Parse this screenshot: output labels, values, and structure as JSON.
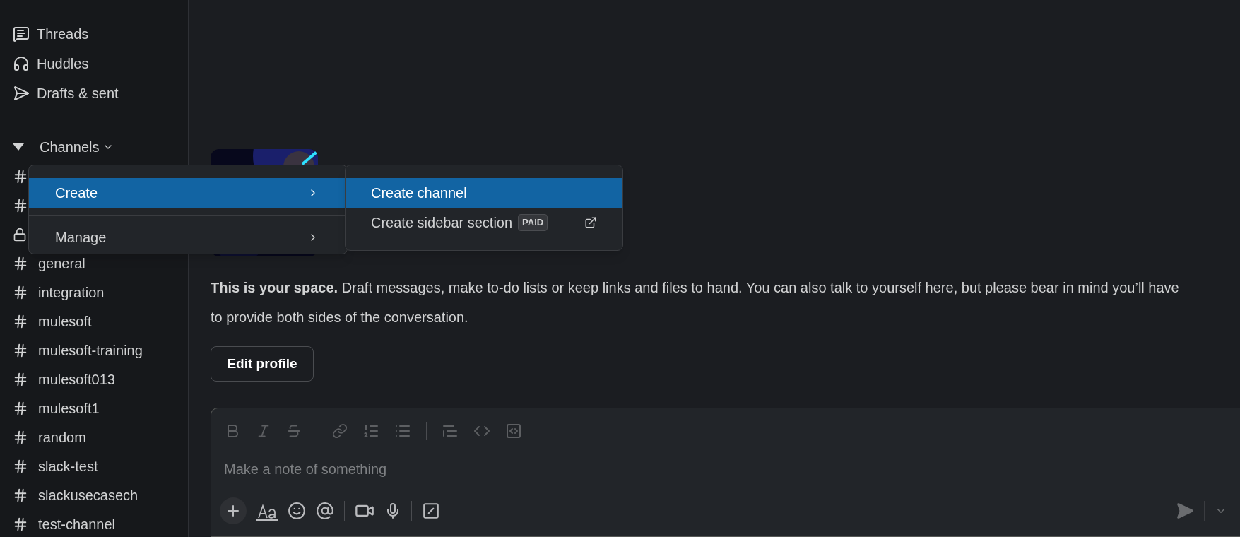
{
  "sidebar": {
    "items": [
      {
        "label": "Threads"
      },
      {
        "label": "Huddles"
      },
      {
        "label": "Drafts & sent"
      }
    ],
    "section": {
      "label": "Channels",
      "expanded": true
    },
    "channels": [
      {
        "kind": "public"
      },
      {
        "kind": "public"
      },
      {
        "kind": "private"
      },
      {
        "kind": "public",
        "name": "general"
      },
      {
        "kind": "public",
        "name": "integration"
      },
      {
        "kind": "public",
        "name": "mulesoft"
      },
      {
        "kind": "public",
        "name": "mulesoft-training"
      },
      {
        "kind": "public",
        "name": "mulesoft013"
      },
      {
        "kind": "public",
        "name": "mulesoft1"
      },
      {
        "kind": "public",
        "name": "random"
      },
      {
        "kind": "public",
        "name": "slack-test"
      },
      {
        "kind": "public",
        "name": "slackusecasech"
      },
      {
        "kind": "public",
        "name": "test-channel"
      }
    ]
  },
  "menu": {
    "items": [
      {
        "label": "Create",
        "selected": true
      },
      {
        "label": "Manage",
        "selected": false
      }
    ]
  },
  "submenu": {
    "items": [
      {
        "label": "Create channel",
        "selected": true
      },
      {
        "label": "Create sidebar section",
        "selected": false,
        "badge": "PAID",
        "external": true
      }
    ]
  },
  "intro": {
    "text": "**This is your space.** Draft messages, make to-do lists or keep links and files to hand. You can also talk to yourself here, but please bear in mind you’ll have to provide both sides of the conversation.",
    "button": "Edit profile"
  },
  "composer": {
    "placeholder": "Make a note of something"
  }
}
